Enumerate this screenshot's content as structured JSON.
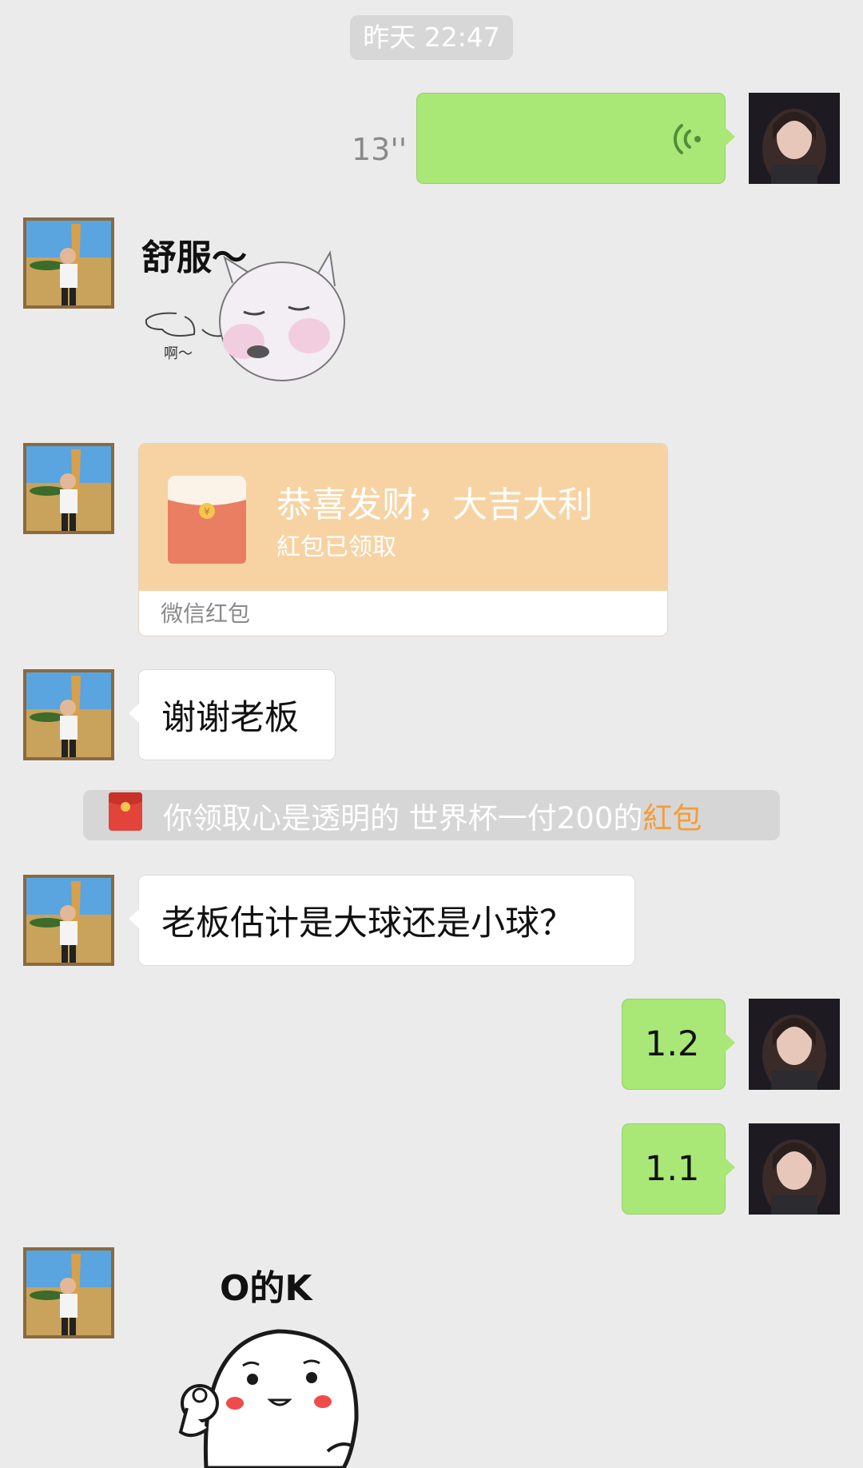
{
  "timestamp": "昨天 22:47",
  "voice_message": {
    "duration": "13''",
    "sender": "me"
  },
  "sticker_1": {
    "caption": "舒服～",
    "sound": "啊～"
  },
  "red_packet": {
    "title": "恭喜发财，大吉大利",
    "status": "紅包已领取",
    "footer": "微信红包"
  },
  "message_thanks": "谢谢老板",
  "system_notice": {
    "prefix": "你领取心是透明的 世界杯一付200的",
    "highlight": "紅包"
  },
  "message_question": "老板估计是大球还是小球？",
  "reply_1": "1.2",
  "reply_2": "1.1",
  "sticker_2": {
    "caption": "O的K"
  },
  "colors": {
    "background": "#ebebeb",
    "my_bubble": "#a9e777",
    "their_bubble": "#ffffff",
    "red_packet": "#f7d3a3",
    "notice_highlight": "#f59c38"
  }
}
